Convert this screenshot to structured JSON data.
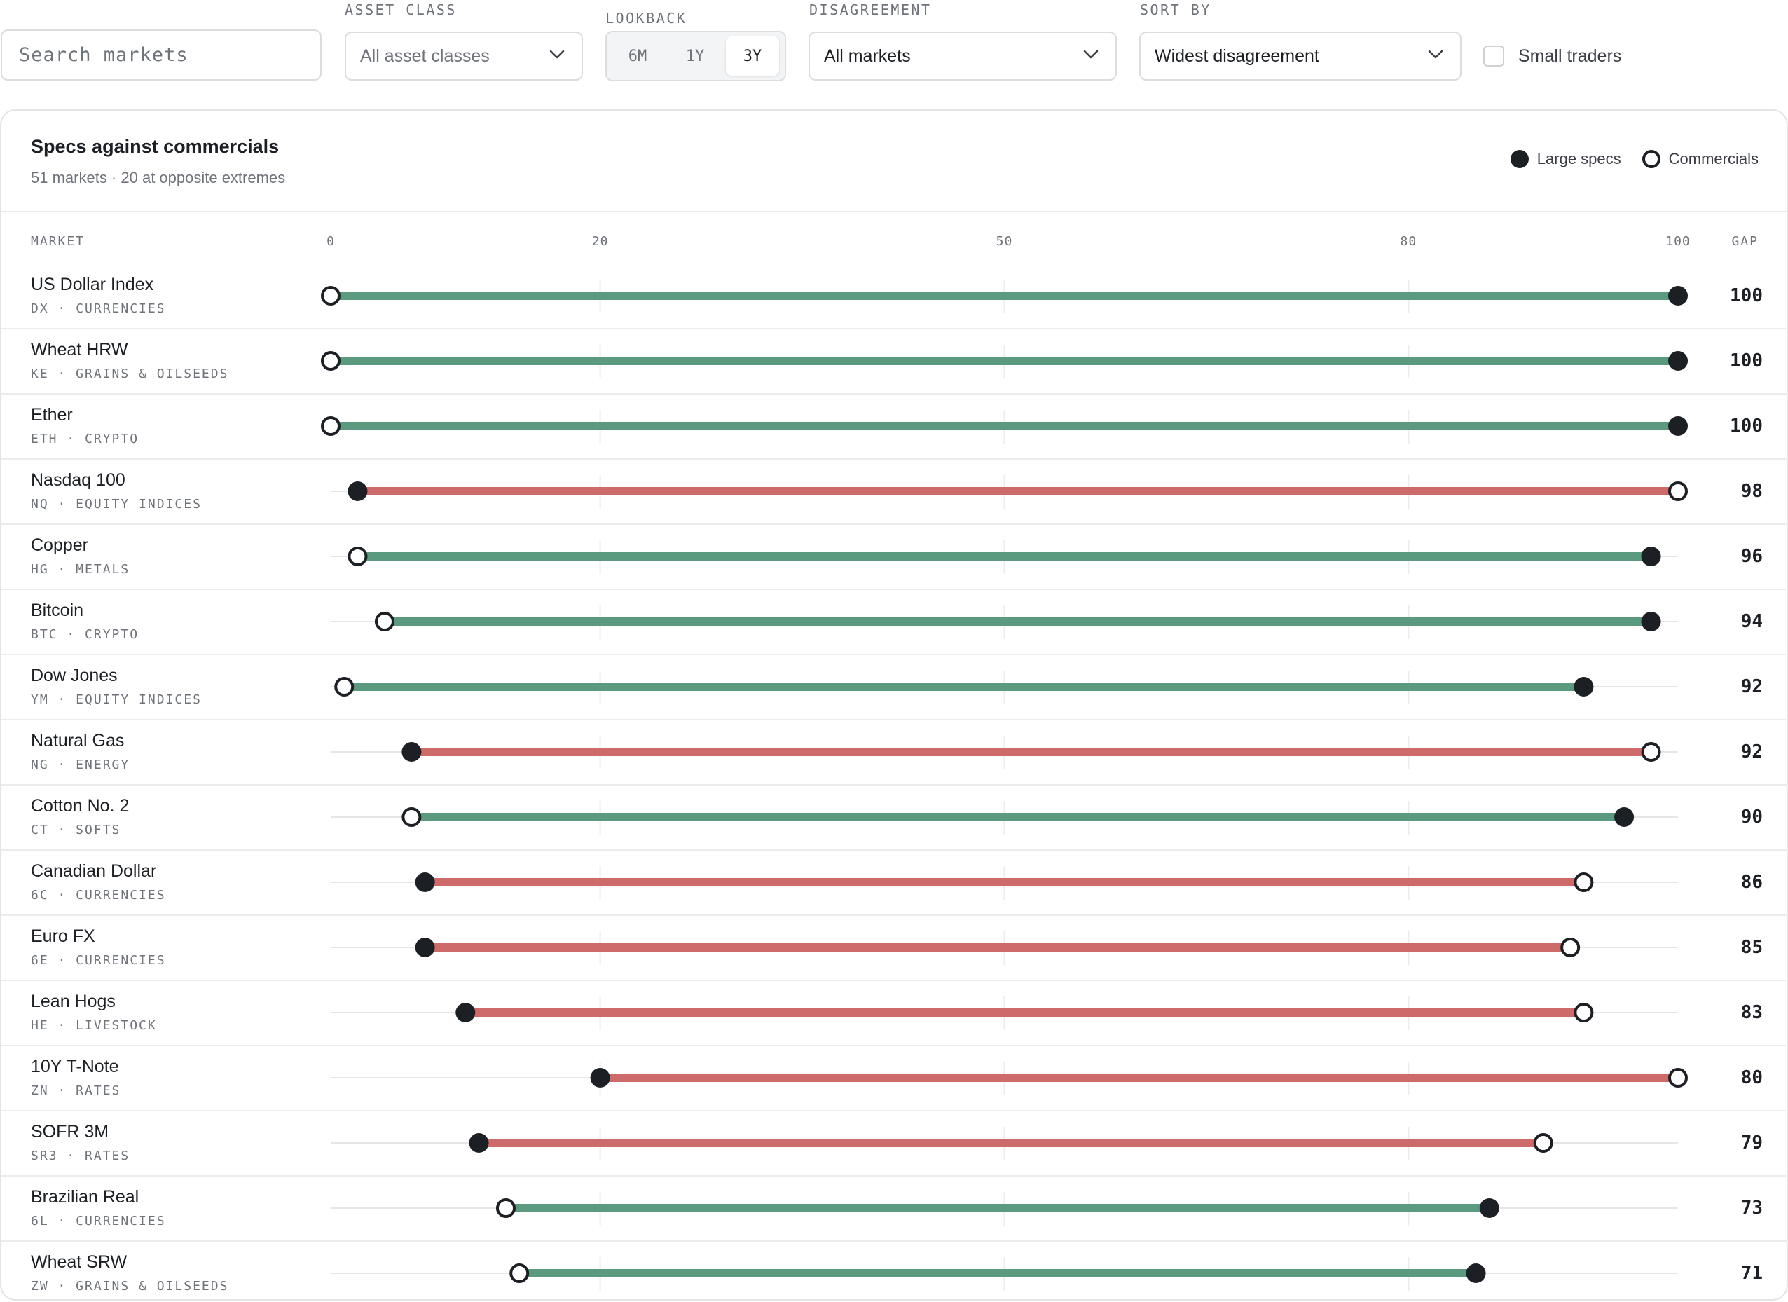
{
  "filters": {
    "search_placeholder": "Search markets",
    "asset_class_label": "ASSET CLASS",
    "asset_class_value": "All asset classes",
    "lookback_label": "LOOKBACK",
    "lookback_options": [
      "6M",
      "1Y",
      "3Y"
    ],
    "lookback_selected": "3Y",
    "disagreement_label": "DISAGREEMENT",
    "disagreement_value": "All markets",
    "sort_label": "SORT BY",
    "sort_value": "Widest disagreement",
    "small_traders_label": "Small traders",
    "small_traders_checked": false
  },
  "card": {
    "title": "Specs against commercials",
    "subtitle": "51 markets · 20 at opposite extremes",
    "legend_specs": "Large specs",
    "legend_commercials": "Commercials",
    "col_market": "MARKET",
    "col_gap": "GAP"
  },
  "colors": {
    "specs_long": "#5b9a7f",
    "specs_short": "#cc6b69",
    "dot": "#1c1f24"
  },
  "chart_data": {
    "type": "dumbbell",
    "xlim": [
      0,
      100
    ],
    "x_ticks": [
      0,
      20,
      50,
      80,
      100
    ],
    "series": [
      {
        "name": "Large specs",
        "key": "specs"
      },
      {
        "name": "Commercials",
        "key": "commercials"
      }
    ],
    "rows": [
      {
        "market": "US Dollar Index",
        "code": "DX · CURRENCIES",
        "specs": 100,
        "commercials": 0,
        "gap": 100
      },
      {
        "market": "Wheat HRW",
        "code": "KE · GRAINS & OILSEEDS",
        "specs": 100,
        "commercials": 0,
        "gap": 100
      },
      {
        "market": "Ether",
        "code": "ETH · CRYPTO",
        "specs": 100,
        "commercials": 0,
        "gap": 100
      },
      {
        "market": "Nasdaq 100",
        "code": "NQ · EQUITY INDICES",
        "specs": 2,
        "commercials": 100,
        "gap": 98
      },
      {
        "market": "Copper",
        "code": "HG · METALS",
        "specs": 98,
        "commercials": 2,
        "gap": 96
      },
      {
        "market": "Bitcoin",
        "code": "BTC · CRYPTO",
        "specs": 98,
        "commercials": 4,
        "gap": 94
      },
      {
        "market": "Dow Jones",
        "code": "YM · EQUITY INDICES",
        "specs": 93,
        "commercials": 1,
        "gap": 92
      },
      {
        "market": "Natural Gas",
        "code": "NG · ENERGY",
        "specs": 6,
        "commercials": 98,
        "gap": 92
      },
      {
        "market": "Cotton No. 2",
        "code": "CT · SOFTS",
        "specs": 96,
        "commercials": 6,
        "gap": 90
      },
      {
        "market": "Canadian Dollar",
        "code": "6C · CURRENCIES",
        "specs": 7,
        "commercials": 93,
        "gap": 86
      },
      {
        "market": "Euro FX",
        "code": "6E · CURRENCIES",
        "specs": 7,
        "commercials": 92,
        "gap": 85
      },
      {
        "market": "Lean Hogs",
        "code": "HE · LIVESTOCK",
        "specs": 10,
        "commercials": 93,
        "gap": 83
      },
      {
        "market": "10Y T-Note",
        "code": "ZN · RATES",
        "specs": 20,
        "commercials": 100,
        "gap": 80
      },
      {
        "market": "SOFR 3M",
        "code": "SR3 · RATES",
        "specs": 11,
        "commercials": 90,
        "gap": 79
      },
      {
        "market": "Brazilian Real",
        "code": "6L · CURRENCIES",
        "specs": 86,
        "commercials": 13,
        "gap": 73
      },
      {
        "market": "Wheat SRW",
        "code": "ZW · GRAINS & OILSEEDS",
        "specs": 85,
        "commercials": 14,
        "gap": 71
      }
    ]
  }
}
